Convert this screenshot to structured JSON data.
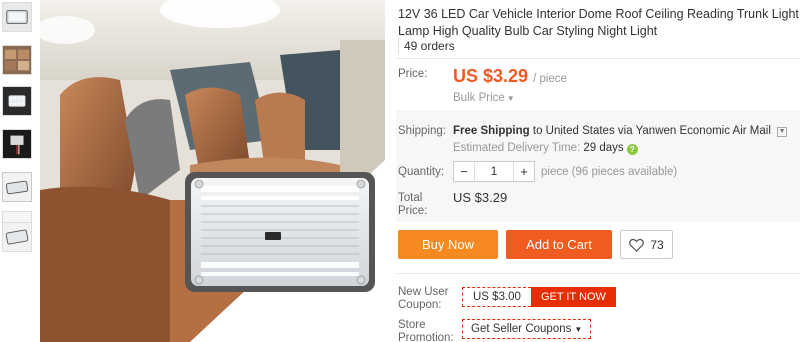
{
  "product": {
    "title": "12V 36 LED Car Vehicle Interior Dome Roof Ceiling Reading Trunk Light Lamp High Quality Bulb Car Styling Night Light",
    "orders": "49 orders"
  },
  "price": {
    "label": "Price:",
    "value": "US $3.29",
    "unit": "/ piece",
    "bulk": "Bulk Price",
    "bulk_icon": "caret-down-icon"
  },
  "shipping": {
    "label": "Shipping:",
    "free": "Free Shipping",
    "to_text": "to United States via Yanwen Economic Air Mail",
    "eta_label": "Estimated Delivery Time:",
    "eta_days": "29 days",
    "help_icon": "question-icon",
    "help_glyph": "?"
  },
  "quantity": {
    "label": "Quantity:",
    "minus": "−",
    "value": "1",
    "plus": "+",
    "note": "piece (96 pieces available)"
  },
  "total": {
    "label_line1": "Total",
    "label_line2": "Price:",
    "value": "US $3.29"
  },
  "actions": {
    "buy_now": "Buy Now",
    "add_to_cart": "Add to Cart",
    "wishlist_count": "73",
    "buy_color": "#f6891f",
    "cart_color": "#f05b20"
  },
  "coupons": {
    "new_user_label_line1": "New User",
    "new_user_label_line2": "Coupon:",
    "new_user_amount": "US $3.00",
    "get_it_now": "GET IT NOW",
    "store_label_line1": "Store",
    "store_label_line2": "Promotion:",
    "seller_coupons": "Get Seller Coupons",
    "accent": "#e62e04"
  },
  "accent_colors": {
    "price": "#f15a22",
    "help": "#8dc63f"
  }
}
